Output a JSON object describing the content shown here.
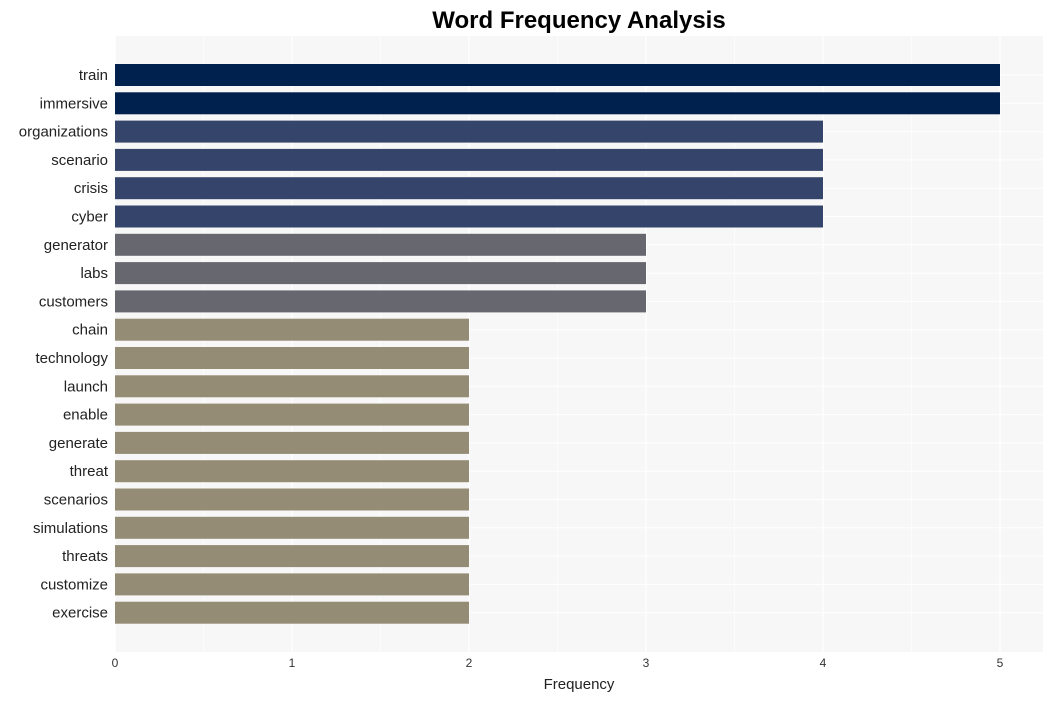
{
  "chart_data": {
    "type": "bar",
    "orientation": "horizontal",
    "title": "Word Frequency Analysis",
    "xlabel": "Frequency",
    "ylabel": "",
    "xlim": [
      0,
      5.25
    ],
    "xticks": [
      0,
      1,
      2,
      3,
      4,
      5
    ],
    "grid": true,
    "categories": [
      "train",
      "immersive",
      "organizations",
      "scenario",
      "crisis",
      "cyber",
      "generator",
      "labs",
      "customers",
      "chain",
      "technology",
      "launch",
      "enable",
      "generate",
      "threat",
      "scenarios",
      "simulations",
      "threats",
      "customize",
      "exercise"
    ],
    "values": [
      5,
      5,
      4,
      4,
      4,
      4,
      3,
      3,
      3,
      2,
      2,
      2,
      2,
      2,
      2,
      2,
      2,
      2,
      2,
      2
    ],
    "color_by_value": {
      "5": "#00204e",
      "4": "#35446b",
      "3": "#67686f",
      "2": "#958c76"
    },
    "background": "#f7f7f7"
  }
}
